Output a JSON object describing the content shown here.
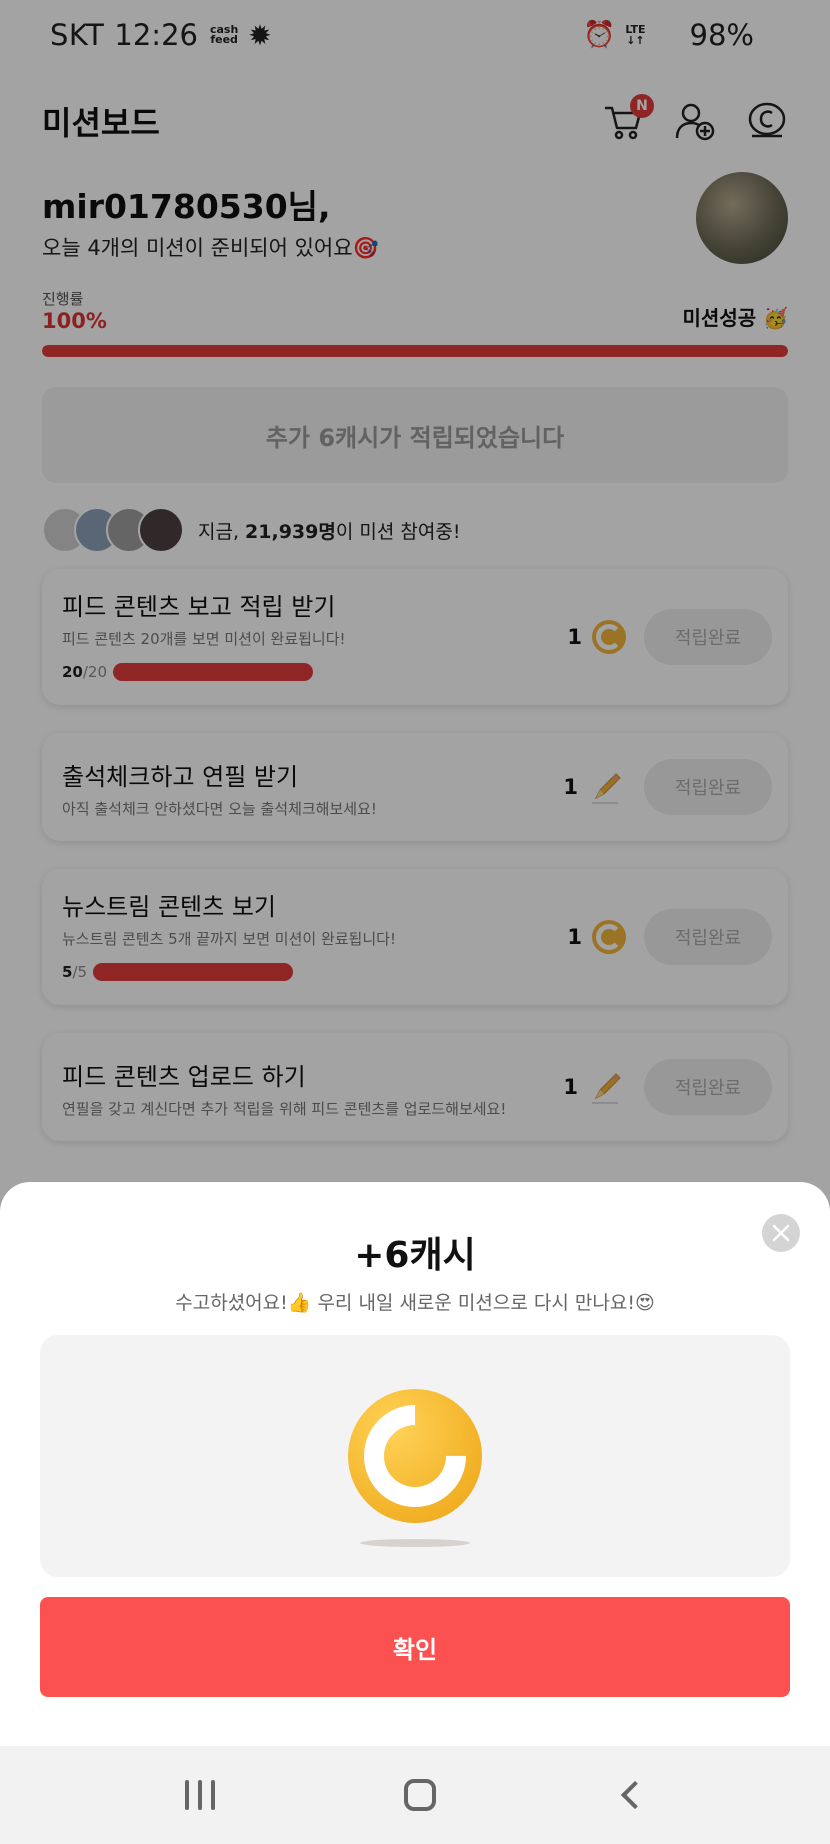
{
  "status_bar": {
    "carrier": "SKT",
    "time": "12:26",
    "cashfeed_line1": "cash",
    "cashfeed_line2": "feed",
    "lte_line1": "LTE",
    "lte_line2": "↓↑",
    "battery": "98%"
  },
  "header": {
    "title": "미션보드",
    "cart_badge": "N"
  },
  "greeting": {
    "username": "mir01780530님,",
    "subtitle": "오늘 4개의 미션이 준비되어 있어요🎯"
  },
  "progress": {
    "label": "진행률",
    "percent_text": "100%",
    "value": 1.0,
    "status": "미션성공 🥳"
  },
  "notice": "추가 6캐시가 적립되었습니다",
  "participants": {
    "prefix": "지금,",
    "count": "21,939명",
    "suffix": "이 미션 참여중!"
  },
  "missions": [
    {
      "title": "피드 콘텐츠 보고 적립 받기",
      "desc": "피드 콘텐츠 20개를 보면 미션이 완료됩니다!",
      "progress_done": "20",
      "progress_total": "/20",
      "reward": "1",
      "reward_icon": "coin-icon",
      "button": "적립완료"
    },
    {
      "title": "출석체크하고 연필 받기",
      "desc": "아직 출석체크 안하셨다면 오늘 출석체크해보세요!",
      "reward": "1",
      "reward_icon": "pencil-icon",
      "button": "적립완료"
    },
    {
      "title": "뉴스트림 콘텐츠 보기",
      "desc": "뉴스트림 콘텐츠 5개 끝까지 보면 미션이 완료됩니다!",
      "progress_done": "5",
      "progress_total": "/5",
      "reward": "1",
      "reward_icon": "coin-icon",
      "button": "적립완료"
    },
    {
      "title": "피드 콘텐츠 업로드 하기",
      "desc": "연필을 갖고 계신다면 추가 적립을 위해 피드 콘텐츠를 업로드해보세요!",
      "reward": "1",
      "reward_icon": "pencil-icon",
      "button": "적립완료"
    }
  ],
  "sheet": {
    "title": "+6캐시",
    "subtitle": "수고하셨어요!👍 우리 내일 새로운 미션으로 다시 만나요!😍",
    "confirm": "확인"
  },
  "colors": {
    "accent": "#e23b3b",
    "confirm_button": "#fb5150",
    "coin": "#f2b126"
  }
}
